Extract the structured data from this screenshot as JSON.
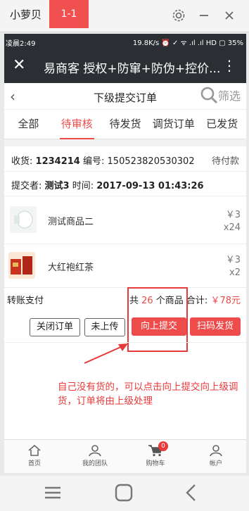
{
  "emulator": {
    "title": "小萝贝",
    "tab": "1-1"
  },
  "status_bar": {
    "time": "凌晨2:49",
    "right": "19.8K/s ⏰ ✓ ᯤ .ıl .ıl HD ▢ 35%"
  },
  "app_header": {
    "title": "易商客 授权+防窜+防伪+控价..."
  },
  "nav": {
    "title": "下级提交订单",
    "filter_label": "筛选"
  },
  "tabs": [
    {
      "label": "全部"
    },
    {
      "label": "待审核"
    },
    {
      "label": "待发货"
    },
    {
      "label": "调货订单"
    },
    {
      "label": "已发货"
    }
  ],
  "order": {
    "receiver_label": "收货:",
    "receiver_value": "1234214",
    "number_label": "编号:",
    "number_value": "150523820530302",
    "payment_status": "待付款",
    "submitter_label": "提交者:",
    "submitter_value": "测试3",
    "time_label": "时间:",
    "time_value": "2017-09-13 01:43:26",
    "items": [
      {
        "name": "测试商品二",
        "price": "￥3",
        "qty": "x24"
      },
      {
        "name": "大红袍红茶",
        "price": "￥3",
        "qty": "x2"
      }
    ],
    "payment_method": "转账支付",
    "summary_prefix": "共",
    "summary_count": "26",
    "summary_mid": "个商品 合计:",
    "summary_total": "￥78元",
    "buttons": {
      "close": "关闭订单",
      "not_uploaded": "未上传",
      "submit_up": "向上提交",
      "scan_ship": "扫码发货"
    }
  },
  "annotation": "自己没有货的，可以点击向上提交向上级调货，订单将由上级处理",
  "bottom_nav": [
    {
      "label": "首页",
      "icon": "home-icon"
    },
    {
      "label": "我的团队",
      "icon": "team-icon"
    },
    {
      "label": "购物车",
      "icon": "cart-icon",
      "badge": "0"
    },
    {
      "label": "帐户",
      "icon": "account-icon"
    }
  ],
  "colors": {
    "accent": "#ee4b4b",
    "header": "#2b2f33",
    "annotation": "#e83a3a"
  }
}
